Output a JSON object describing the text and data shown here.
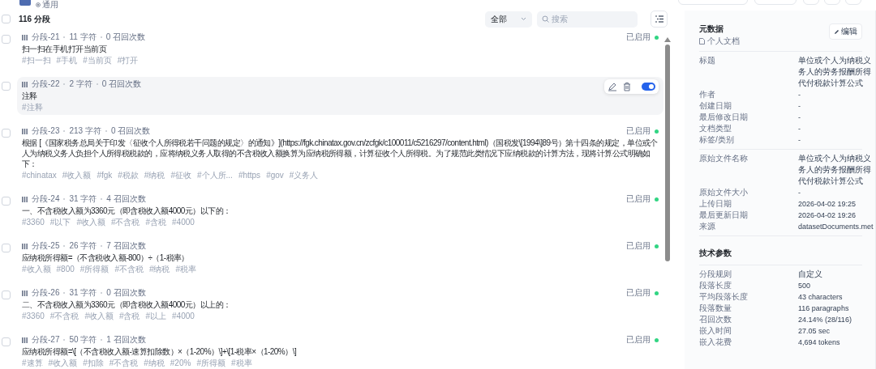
{
  "header": {
    "tag": "通用"
  },
  "list": {
    "count": "116 分段",
    "select_all_checked": false,
    "filter": {
      "value": "全部"
    },
    "search": {
      "placeholder": "搜索"
    }
  },
  "segments": [
    {
      "id": "分段-21",
      "chars": "11 字符",
      "recalls": "0 召回次数",
      "content": "扫一扫在手机打开当前页",
      "keywords": [
        "#扫一扫",
        "#手机",
        "#当前页",
        "#打开"
      ],
      "status": "已启用",
      "enabled": true,
      "hovered": false,
      "checked": false
    },
    {
      "id": "分段-22",
      "chars": "2 字符",
      "recalls": "0 召回次数",
      "content": "注释",
      "keywords": [
        "#注释"
      ],
      "enabled": true,
      "hovered": true,
      "checked": false
    },
    {
      "id": "分段-23",
      "chars": "213 字符",
      "recalls": "0 召回次数",
      "content": "根据 [《国家税务总局关于印发〈征收个人所得税若干问题的规定〉的通知》](https://fgk.chinatax.gov.cn/zcfgk/c100011/c5216297/content.html)（国税发\\[1994\\]89号）第十四条的规定，单位或个人为纳税义务人负担个人所得税税款的，应将纳税义务人取得的不含税收入额换算为应纳税所得额，计算征收个人所得税。为了规范此类情况下应纳税款的计算方法，现将计算公式明确如下：",
      "keywords": [
        "#chinatax",
        "#收入额",
        "#fgk",
        "#税款",
        "#纳税",
        "#征收",
        "#个人所...",
        "#https",
        "#gov",
        "#义务人"
      ],
      "status": "已启用",
      "enabled": true,
      "hovered": false,
      "checked": false
    },
    {
      "id": "分段-24",
      "chars": "31 字符",
      "recalls": "4 召回次数",
      "content": "一、不含税收入额为3360元（即含税收入额4000元）以下的：",
      "keywords": [
        "#3360",
        "#以下",
        "#收入额",
        "#不含税",
        "#含税",
        "#4000"
      ],
      "status": "已启用",
      "enabled": true,
      "hovered": false,
      "checked": false
    },
    {
      "id": "分段-25",
      "chars": "26 字符",
      "recalls": "7 召回次数",
      "content": "应纳税所得额=（不含税收入额-800）÷（1-税率）",
      "keywords": [
        "#收入额",
        "#800",
        "#所得额",
        "#不含税",
        "#纳税",
        "#税率"
      ],
      "status": "已启用",
      "enabled": true,
      "hovered": false,
      "checked": false
    },
    {
      "id": "分段-26",
      "chars": "31 字符",
      "recalls": "0 召回次数",
      "content": "二、不含税收入额为3360元（即含税收入额4000元）以上的：",
      "keywords": [
        "#3360",
        "#不含税",
        "#收入额",
        "#含税",
        "#以上",
        "#4000"
      ],
      "status": "已启用",
      "enabled": true,
      "hovered": false,
      "checked": false
    },
    {
      "id": "分段-27",
      "chars": "50 字符",
      "recalls": "1 召回次数",
      "content": "应纳税所得额=\\[（不含税收入额-速算扣除数）×（1-20%）\\]+\\[1-税率×（1-20%）\\]",
      "keywords": [
        "#速算",
        "#收入额",
        "#扣除",
        "#不含税",
        "#纳税",
        "#20%",
        "#所得额",
        "#税率"
      ],
      "status": "已启用",
      "enabled": true,
      "hovered": false,
      "checked": false
    }
  ],
  "metadata": {
    "title": "元数据",
    "subtitle": "个人文档",
    "edit_button": "编辑",
    "groups": [
      [
        {
          "label": "标题",
          "value": "单位或个人为纳税义务人的劳务报酬所得代付税款计算公式"
        },
        {
          "label": "作者",
          "value": "-"
        },
        {
          "label": "创建日期",
          "value": "-"
        },
        {
          "label": "最后修改日期",
          "value": "-"
        },
        {
          "label": "文档类型",
          "value": "-"
        },
        {
          "label": "标签/类别",
          "value": "-"
        }
      ],
      [
        {
          "label": "原始文件名称",
          "value": "单位或个人为纳税义务人的劳务报酬所得代付税款计算公式"
        },
        {
          "label": "原始文件大小",
          "value": "-"
        },
        {
          "label": "上传日期",
          "value": "2026-04-02 19:25"
        },
        {
          "label": "最后更新日期",
          "value": "2026-04-02 19:26"
        },
        {
          "label": "来源",
          "value": "datasetDocuments.met"
        }
      ]
    ]
  },
  "technical": {
    "title": "技术参数",
    "rows": [
      {
        "label": "分段规则",
        "value": "自定义"
      },
      {
        "label": "段落长度",
        "value": "500"
      },
      {
        "label": "平均段落长度",
        "value": "43 characters"
      },
      {
        "label": "段落数量",
        "value": "116 paragraphs"
      },
      {
        "label": "召回次数",
        "value": "24.14% (28/116)"
      },
      {
        "label": "嵌入时间",
        "value": "27.05 sec"
      },
      {
        "label": "嵌入花费",
        "value": "4,694 tokens"
      }
    ]
  }
}
